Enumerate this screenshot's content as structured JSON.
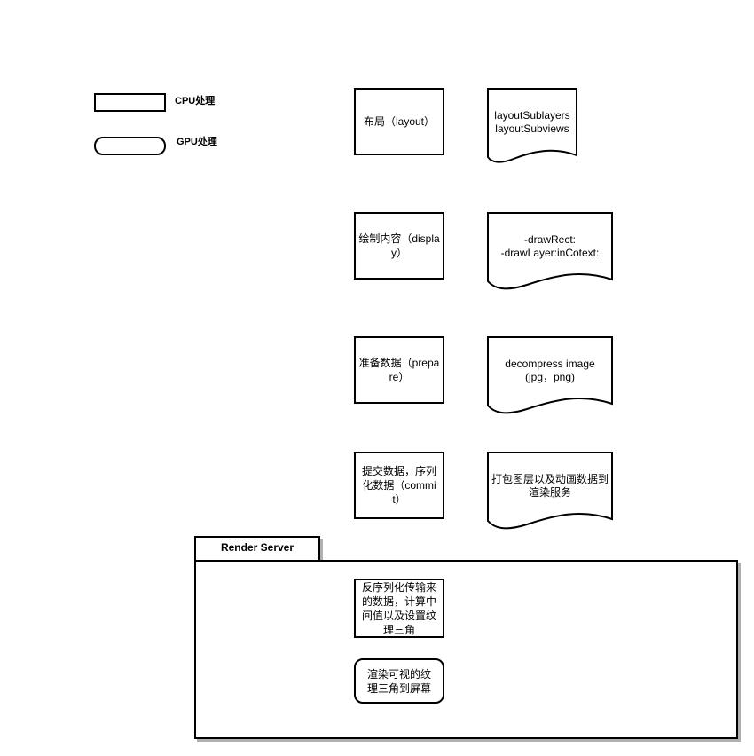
{
  "legend": {
    "cpu_label": "CPU处理",
    "gpu_label": "GPU处理"
  },
  "steps": [
    {
      "process": "布局（layout）",
      "detail_lines": [
        "layoutSublayers",
        "layoutSubviews"
      ]
    },
    {
      "process": "绘制内容（display）",
      "detail_lines": [
        "-drawRect:",
        "-drawLayer:inCotext:"
      ]
    },
    {
      "process": "准备数据（prepare）",
      "detail_lines": [
        "decompress image",
        "(jpg，png)"
      ]
    },
    {
      "process": "提交数据，序列化数据（commit）",
      "detail_lines": [
        "打包图层以及动画数据到",
        "渲染服务"
      ]
    }
  ],
  "render_server": {
    "title": "Render Server",
    "cpu_step": "反序列化传输来的数据，计算中间值以及设置纹理三角",
    "gpu_step": "渲染可视的纹理三角到屏幕"
  }
}
